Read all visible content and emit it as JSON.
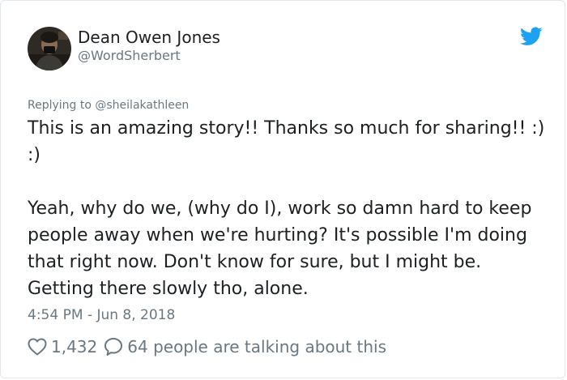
{
  "tweet": {
    "author": {
      "display_name": "Dean Owen Jones",
      "handle": "@WordSherbert",
      "avatar_icon": "user-photo-avatar"
    },
    "brand_icon": "twitter-bird-icon",
    "brand_color": "#1da1f2",
    "reply_context": "Replying to @sheilakathleen",
    "text": "This is an amazing story!! Thanks so much for sharing!! :) :)\n\nYeah, why do we, (why do I), work so damn hard to keep people away when we're hurting? It's possible I'm doing that right now. Don't know for sure, but I might be. Getting there slowly tho, alone.",
    "timestamp": "4:54 PM - Jun 8, 2018",
    "likes": {
      "icon": "heart-icon",
      "count": "1,432"
    },
    "conversation": {
      "icon": "speech-bubble-icon",
      "label": "64 people are talking about this"
    },
    "colors": {
      "text": "#1c2022",
      "secondary_text": "#697882",
      "border": "#e1e8ed"
    }
  }
}
